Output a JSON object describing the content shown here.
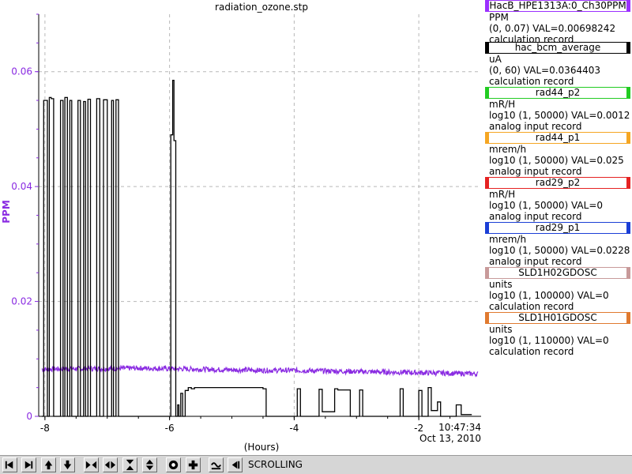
{
  "chart_data": {
    "type": "line",
    "title": "radiation_ozone.stp",
    "xlabel": "(Hours)",
    "ylabel": "PPM",
    "x_ticks": [
      "-8",
      "-6",
      "-4",
      "-2"
    ],
    "x_tick_values": [
      -8,
      -6,
      -4,
      -2
    ],
    "y_ticks": [
      "0",
      "0.02",
      "0.04",
      "0.06"
    ],
    "y_tick_values": [
      0,
      0.02,
      0.04,
      0.06
    ],
    "xlim": [
      -8.1,
      -1.0
    ],
    "ylim": [
      0,
      0.07
    ],
    "time_label": "10:47:34",
    "date_label": "Oct 13, 2010",
    "grid": true,
    "series": [
      {
        "name": "HacB_HPE1313A:0_Ch30PPM",
        "color": "#8a2be2",
        "style": "noisy-band",
        "x": [
          -8.05,
          -7.5,
          -7.0,
          -6.5,
          -6.0,
          -5.5,
          -5.0,
          -4.5,
          -4.0,
          -3.5,
          -3.0,
          -2.5,
          -2.0,
          -1.5,
          -1.05
        ],
        "values": [
          0.0082,
          0.0083,
          0.0083,
          0.0084,
          0.0083,
          0.0082,
          0.0081,
          0.008,
          0.008,
          0.0079,
          0.0078,
          0.0077,
          0.0076,
          0.0075,
          0.0074
        ]
      },
      {
        "name": "hac_bcm_average",
        "color": "#000000",
        "style": "step",
        "x": [
          -8.05,
          -8.02,
          -7.98,
          -7.96,
          -7.93,
          -7.9,
          -7.86,
          -7.8,
          -7.75,
          -7.71,
          -7.68,
          -7.64,
          -7.6,
          -7.57,
          -7.52,
          -7.47,
          -7.43,
          -7.38,
          -7.35,
          -7.31,
          -7.27,
          -7.22,
          -7.17,
          -7.12,
          -7.06,
          -7.0,
          -6.96,
          -6.93,
          -6.9,
          -6.86,
          -6.82,
          -6.05,
          -5.98,
          -5.95,
          -5.93,
          -5.9,
          -5.87,
          -5.85,
          -5.82,
          -5.79,
          -5.75,
          -5.7,
          -5.65,
          -5.6,
          -5.55,
          -5.5,
          -5.45,
          -4.5,
          -4.45,
          -3.95,
          -3.9,
          -3.6,
          -3.55,
          -3.35,
          -3.3,
          -3.1,
          -2.95,
          -2.9,
          -2.3,
          -2.25,
          -2.0,
          -1.95,
          -1.85,
          -1.8,
          -1.7,
          -1.65,
          -1.4,
          -1.32,
          -1.2,
          -1.15
        ],
        "values": [
          0.0,
          0.055,
          0.055,
          0.0,
          0.0555,
          0.0553,
          0.0,
          0.0,
          0.055,
          0.0,
          0.0555,
          0.0,
          0.055,
          0.0,
          0.0,
          0.055,
          0.0,
          0.0548,
          0.0,
          0.0552,
          0.0,
          0.0,
          0.0553,
          0.0,
          0.0551,
          0.0,
          0.0,
          0.055,
          0.0,
          0.0551,
          0.0,
          0.0,
          0.049,
          0.0585,
          0.048,
          0.0,
          0.002,
          0.0,
          0.004,
          0.0,
          0.0045,
          0.005,
          0.0048,
          0.005,
          0.005,
          0.005,
          0.005,
          0.0048,
          0.0,
          0.0048,
          0.0,
          0.0047,
          0.0008,
          0.0048,
          0.0046,
          0.0,
          0.0046,
          0.0,
          0.0048,
          0.0,
          0.0045,
          0.0,
          0.005,
          0.001,
          0.0025,
          0.0,
          0.002,
          0.0003,
          0.0003,
          0.0003
        ]
      }
    ]
  },
  "legend": [
    {
      "name": "HacB_HPE1313A:0_Ch30PPM",
      "color": "#9b30ff",
      "units": "PPM",
      "range": "(0, 0.07) VAL=0.00698242",
      "record": "calculation record"
    },
    {
      "name": "hac_bcm_average",
      "color": "#000000",
      "units": "uA",
      "range": "(0, 60) VAL=0.0364403",
      "record": "calculation record"
    },
    {
      "name": "rad44_p2",
      "color": "#22cc22",
      "units": "mR/H",
      "range": "log10 (1, 50000) VAL=0.0012",
      "record": "analog input record"
    },
    {
      "name": "rad44_p1",
      "color": "#f5a623",
      "units": "mrem/h",
      "range": "log10 (1, 50000) VAL=0.025",
      "record": "analog input record"
    },
    {
      "name": "rad29_p2",
      "color": "#e52222",
      "units": "mR/H",
      "range": "log10 (1, 50000) VAL=0",
      "record": "analog input record"
    },
    {
      "name": "rad29_p1",
      "color": "#1b3fd6",
      "units": "mrem/h",
      "range": "log10 (1, 50000) VAL=0.0228",
      "record": "analog input record"
    },
    {
      "name": "SLD1H02GDOSC",
      "color": "#c89a9a",
      "units": "units",
      "range": "log10 (1, 100000) VAL=0",
      "record": "calculation record"
    },
    {
      "name": "SLD1H01GDOSC",
      "color": "#e07a30",
      "units": "units",
      "range": "log10 (1, 110000) VAL=0",
      "record": "calculation record"
    }
  ],
  "toolbar": {
    "status": "SCROLLING",
    "buttons": [
      {
        "id": "pan-left",
        "icon": "arrow-left-icon"
      },
      {
        "id": "pan-right",
        "icon": "arrow-right-icon"
      },
      {
        "id": "pan-up",
        "icon": "arrow-up-icon"
      },
      {
        "id": "pan-down",
        "icon": "arrow-down-icon"
      },
      {
        "id": "zoom-in-x",
        "icon": "zoom-in-x-icon"
      },
      {
        "id": "zoom-out-x",
        "icon": "zoom-out-x-icon"
      },
      {
        "id": "zoom-in-y",
        "icon": "zoom-in-y-icon"
      },
      {
        "id": "zoom-out-y",
        "icon": "zoom-out-y-icon"
      },
      {
        "id": "config",
        "icon": "config-circle-icon"
      },
      {
        "id": "add",
        "icon": "plus-icon"
      },
      {
        "id": "mode",
        "icon": "wave-icon"
      },
      {
        "id": "scroll",
        "icon": "scroll-left-icon"
      }
    ]
  }
}
